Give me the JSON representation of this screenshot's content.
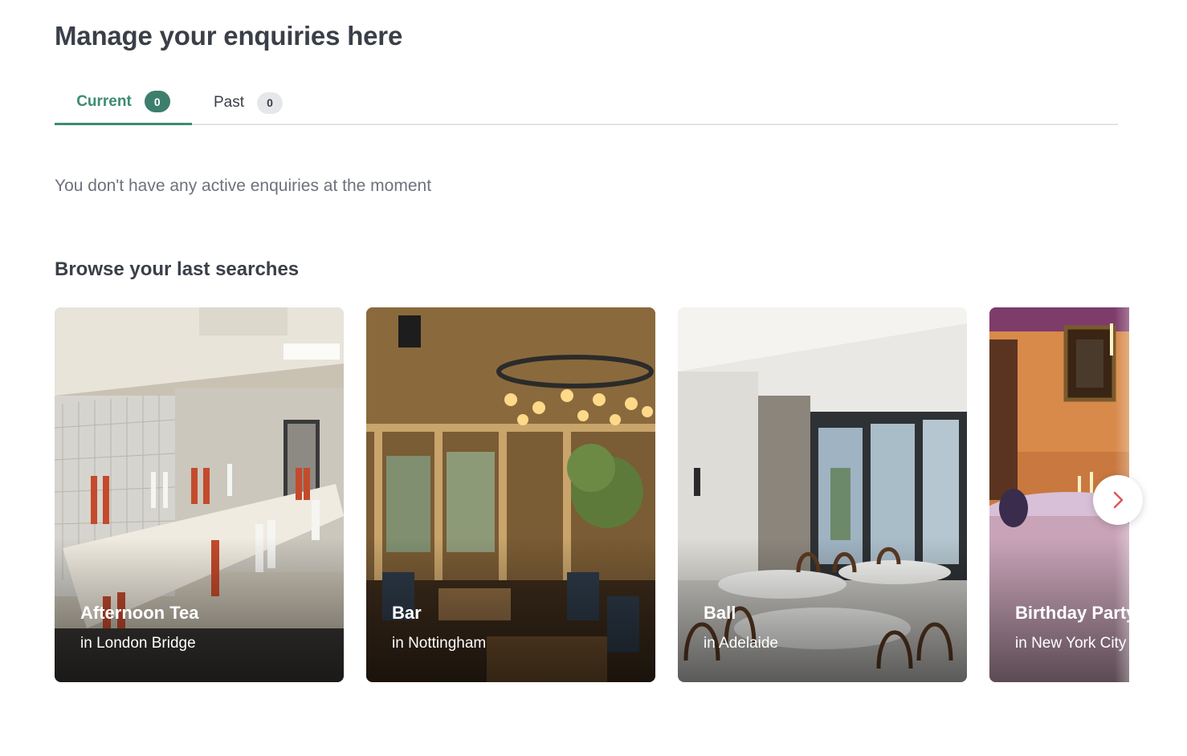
{
  "page": {
    "title": "Manage your enquiries here"
  },
  "tabs": [
    {
      "label": "Current",
      "count": "0",
      "active": true
    },
    {
      "label": "Past",
      "count": "0",
      "active": false
    }
  ],
  "empty_state": {
    "message": "You don't have any active enquiries at the moment"
  },
  "recent_searches": {
    "title": "Browse your last searches",
    "cards": [
      {
        "title": "Afternoon Tea",
        "location": "in London Bridge"
      },
      {
        "title": "Bar",
        "location": "in Nottingham"
      },
      {
        "title": "Ball",
        "location": "in Adelaide"
      },
      {
        "title": "Birthday Party",
        "location": "in New York City"
      }
    ],
    "next_icon": "chevron-right-icon"
  },
  "colors": {
    "accent": "#3d8b74",
    "badge_active": "#3d7f6c",
    "badge_inactive": "#e6e7ea",
    "next_arrow": "#e0565b",
    "heading_text": "#3a3f48",
    "muted_text": "#6d727c"
  }
}
